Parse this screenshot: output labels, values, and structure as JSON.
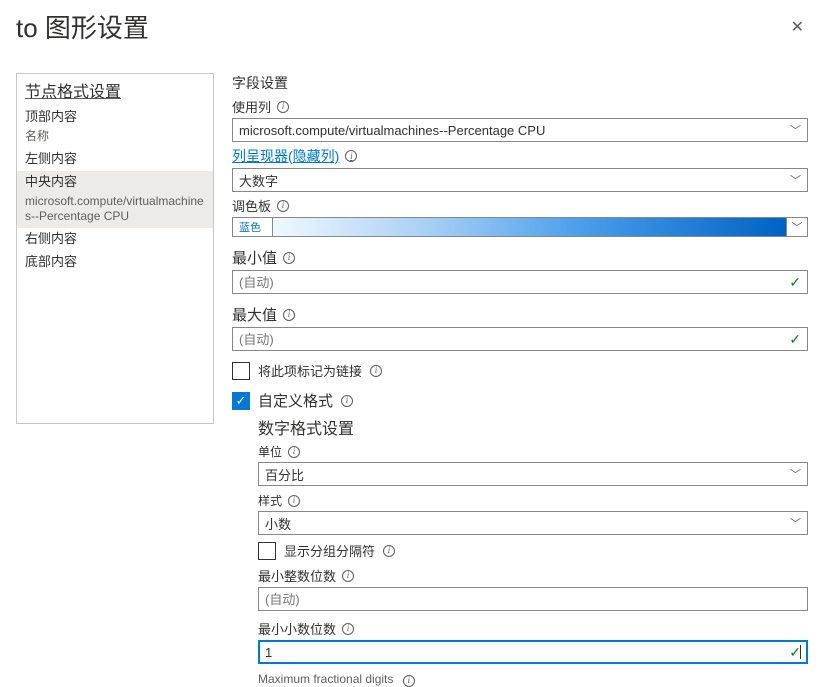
{
  "header": {
    "title": "to 图形设置"
  },
  "sidebar": {
    "header": "节点格式设置",
    "items": [
      {
        "label": "顶部内容",
        "sub": "名称"
      },
      {
        "label": "左侧内容",
        "sub": ""
      },
      {
        "label": "中央内容",
        "sub": "microsoft.compute/virtualmachines--Percentage CPU",
        "selected": true
      },
      {
        "label": "右侧内容",
        "sub": ""
      },
      {
        "label": "底部内容",
        "sub": ""
      }
    ]
  },
  "main": {
    "section_label": "字段设置",
    "use_column": {
      "label": "使用列",
      "value": "microsoft.compute/virtualmachines--Percentage CPU"
    },
    "renderer": {
      "label": "列呈现器(隐藏列)",
      "value": "大数字"
    },
    "palette": {
      "label": "调色板",
      "value": "蓝色"
    },
    "min": {
      "label": "最小值",
      "placeholder": "(自动)"
    },
    "max": {
      "label": "最大值",
      "placeholder": "(自动)"
    },
    "mark_link": {
      "label": "将此项标记为链接",
      "checked": false
    },
    "custom_format": {
      "label": "自定义格式",
      "checked": true
    },
    "number_format": {
      "title": "数字格式设置",
      "unit": {
        "label": "单位",
        "value": "百分比"
      },
      "style": {
        "label": "样式",
        "value": "小数"
      },
      "show_sep": {
        "label": "显示分组分隔符",
        "checked": false
      },
      "min_int": {
        "label": "最小整数位数",
        "placeholder": "(自动)"
      },
      "min_frac": {
        "label": "最小小数位数",
        "value": "1"
      },
      "max_frac_cut": "Maximum fractional digits"
    }
  }
}
